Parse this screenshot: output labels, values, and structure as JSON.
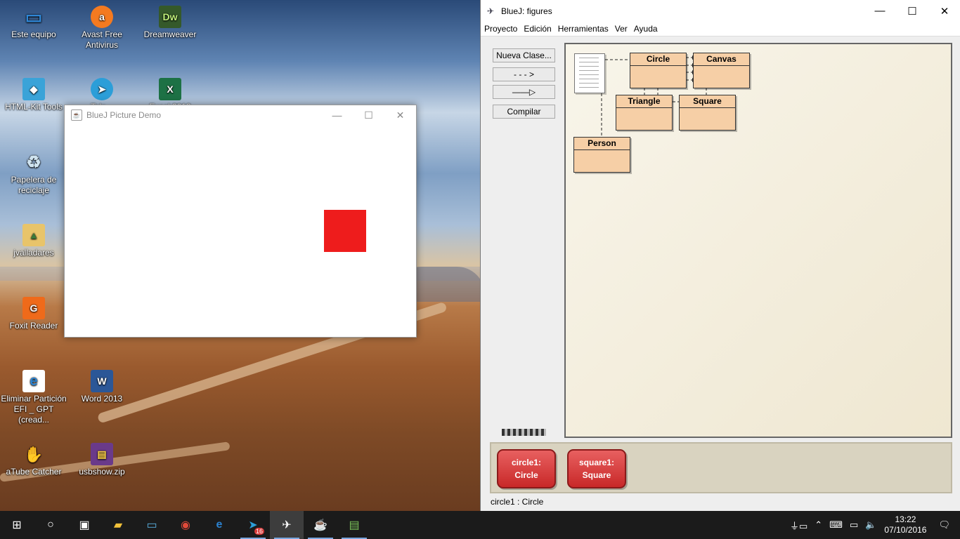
{
  "desktop": {
    "icons": [
      {
        "label": "Este equipo",
        "glyph": "▭",
        "color": "#2f86d6"
      },
      {
        "label": "Avast Free Antivirus",
        "glyph": "a",
        "color": "#f47a20"
      },
      {
        "label": "Dreamweaver",
        "glyph": "Dw",
        "color": "#35592a"
      },
      {
        "label": "HTML-Kit Tools",
        "glyph": "◆",
        "color": "#3aa3d8"
      },
      {
        "label": "Tele...",
        "glyph": "➤",
        "color": "#2c9ed8"
      },
      {
        "label": "Excel 2013",
        "glyph": "X",
        "color": "#1d7145"
      },
      {
        "label": "Papelera de reciclaje",
        "glyph": "♻",
        "color": "#cfd8df"
      },
      {
        "label": "jvalladares",
        "glyph": "▲",
        "color": "#e8c46a"
      },
      {
        "label": "Foxit Reader",
        "glyph": "G",
        "color": "#ef6a1a"
      },
      {
        "label": "Eliminar Partición EFI _ GPT (cread...",
        "glyph": "e",
        "color": "#2b82d0"
      },
      {
        "label": "Word 2013",
        "glyph": "W",
        "color": "#2b5797"
      },
      {
        "label": "aTube Catcher",
        "glyph": "✋",
        "color": "#d24a2a"
      },
      {
        "label": "usbshow.zip",
        "glyph": "▤",
        "color": "#6a3a8a"
      }
    ]
  },
  "demo_window": {
    "title": "BlueJ Picture Demo",
    "shape_color": "#ee1c1c"
  },
  "bluej": {
    "title": "BlueJ:  figures",
    "menu": [
      "Proyecto",
      "Edición",
      "Herramientas",
      "Ver",
      "Ayuda"
    ],
    "tools": {
      "new_class": "Nueva Clase...",
      "uses_arrow": "- - - >",
      "inherits_arrow": "——▷",
      "compile": "Compilar"
    },
    "classes": [
      "Circle",
      "Canvas",
      "Triangle",
      "Square",
      "Person"
    ],
    "objects": [
      {
        "line1": "circle1:",
        "line2": "Circle"
      },
      {
        "line1": "square1:",
        "line2": "Square"
      }
    ],
    "status": "circle1 : Circle"
  },
  "taskbar": {
    "apps": [
      "start-icon",
      "cortana-icon",
      "task-view-icon",
      "file-explorer-icon",
      "computer-icon",
      "chrome-icon",
      "edge-icon",
      "telegram-icon",
      "bluej-icon",
      "java-icon",
      "notepad-icon"
    ],
    "telegram_badge": "16",
    "time": "13:22",
    "date": "07/10/2016"
  }
}
